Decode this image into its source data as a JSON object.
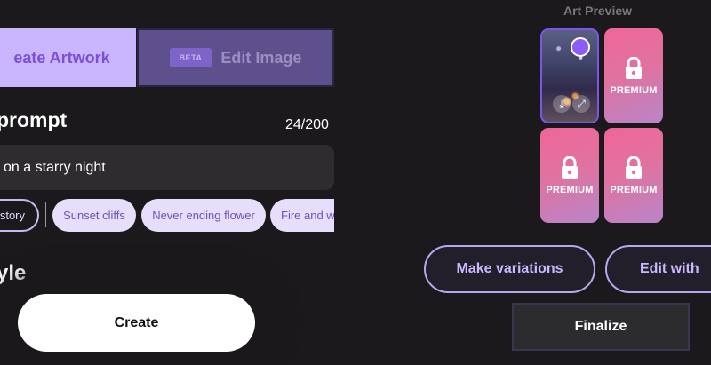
{
  "tabs": {
    "create_label": "eate Artwork",
    "edit_label": "Edit Image",
    "beta_badge": "BETA"
  },
  "prompt": {
    "heading": "prompt",
    "char_count": "24/200",
    "value": "on a starry night"
  },
  "suggestions": {
    "history_label": "istory",
    "chips": [
      "Sunset cliffs",
      "Never ending flower",
      "Fire and w"
    ]
  },
  "style": {
    "heading": "yle"
  },
  "create_button": "Create",
  "preview": {
    "title": "Art Preview",
    "tiles": [
      {
        "kind": "image",
        "selected": true
      },
      {
        "kind": "locked",
        "label": "PREMIUM",
        "icon": "lock-icon"
      },
      {
        "kind": "locked",
        "label": "PREMIUM",
        "icon": "lock-icon"
      },
      {
        "kind": "locked",
        "label": "PREMIUM",
        "icon": "lock-icon"
      }
    ]
  },
  "actions": {
    "make_variations": "Make variations",
    "edit_with": "Edit with",
    "finalize": "Finalize"
  },
  "colors": {
    "background": "#1b191b",
    "accent": "#cab6ff",
    "premium_gradient_start": "#f0669a",
    "premium_gradient_end": "#b985c9"
  }
}
